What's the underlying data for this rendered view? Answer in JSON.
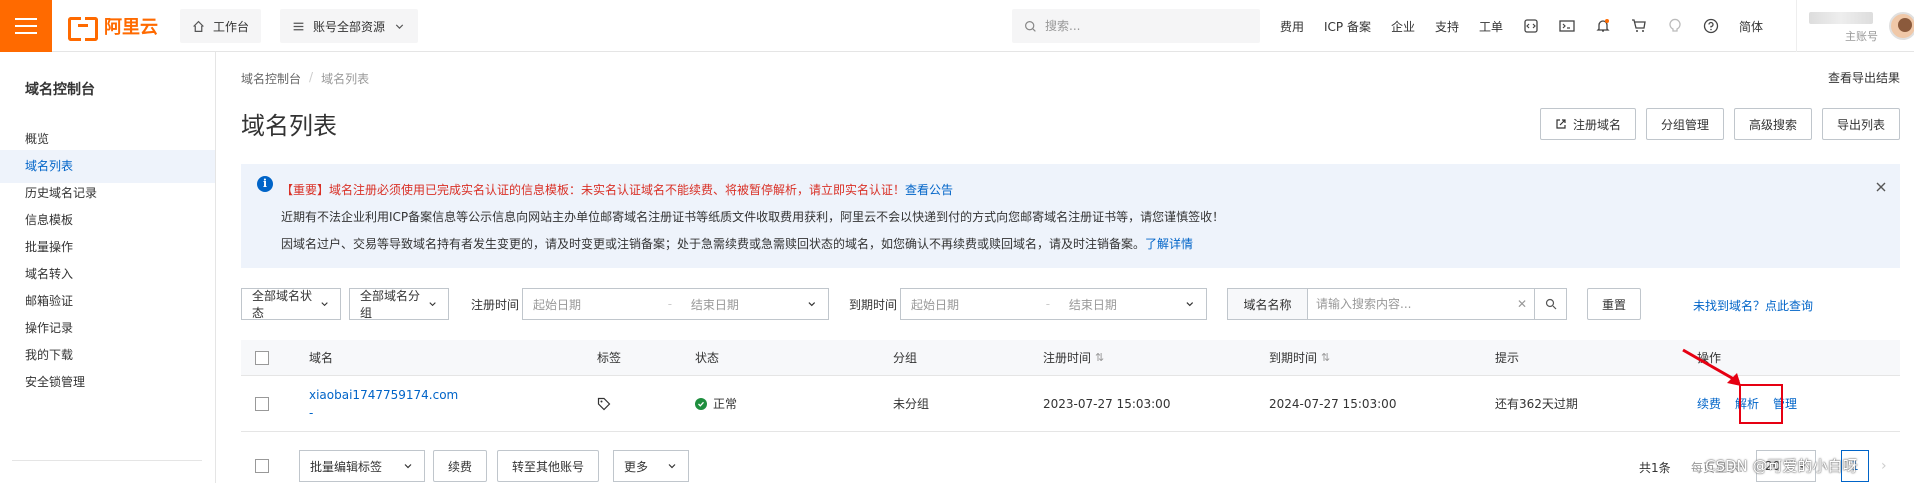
{
  "topbar": {
    "logo_text": "阿里云",
    "workbench_label": "工作台",
    "resource_label": "账号全部资源",
    "search_placeholder": "搜索...",
    "nav_links": [
      "费用",
      "ICP 备案",
      "企业",
      "支持",
      "工单"
    ],
    "lang_label": "简体",
    "user_sub": "主账号",
    "accent_color": "#ff6a00"
  },
  "sidebar": {
    "title": "域名控制台",
    "items": [
      {
        "label": "概览"
      },
      {
        "label": "域名列表",
        "active": true
      },
      {
        "label": "历史域名记录"
      },
      {
        "label": "信息模板"
      },
      {
        "label": "批量操作"
      },
      {
        "label": "域名转入"
      },
      {
        "label": "邮箱验证"
      },
      {
        "label": "操作记录"
      },
      {
        "label": "我的下载"
      },
      {
        "label": "安全锁管理"
      }
    ]
  },
  "main": {
    "breadcrumb": [
      "域名控制台",
      "域名列表"
    ],
    "export_link": "查看导出结果",
    "title": "域名列表",
    "header_buttons": {
      "register": "注册域名",
      "group": "分组管理",
      "advanced": "高级搜索",
      "export": "导出列表"
    }
  },
  "notice": {
    "line1_text": "【重要】域名注册必须使用已完成实名认证的信息模板：未实名认证域名不能续费、将被暂停解析，请立即实名认证！",
    "line1_link": "查看公告",
    "line2_text": "近期有不法企业利用ICP备案信息等公示信息向网站主办单位邮寄域名注册证书等纸质文件收取费用获利，阿里云不会以快递到付的方式向您邮寄域名注册证书等，请您谨慎签收！",
    "line3_text": "因域名过户、交易等导致域名持有者发生变更的，请及时变更或注销备案；处于急需续费或急需赎回状态的域名，如您确认不再续费或赎回域名，请及时注销备案。",
    "line3_link": "了解详情"
  },
  "filters": {
    "status_select": "全部域名状态",
    "group_select": "全部域名分组",
    "reg_time_label": "注册时间",
    "exp_time_label": "到期时间",
    "start_date": "起始日期",
    "end_date": "结束日期",
    "search_field": "域名名称",
    "search_placeholder": "请输入搜索内容...",
    "reset": "重置",
    "not_found": "未找到域名？点此查询"
  },
  "table": {
    "headers": {
      "domain": "域名",
      "tag": "标签",
      "status": "状态",
      "group": "分组",
      "reg_time": "注册时间",
      "exp_time": "到期时间",
      "tip": "提示",
      "ops": "操作"
    },
    "rows": [
      {
        "domain": "xiaobai1747759174.com",
        "domain_sub": "-",
        "status": "正常",
        "group": "未分组",
        "reg_time": "2023-07-27 15:03:00",
        "exp_time": "2024-07-27 15:03:00",
        "tip": "还有362天过期",
        "ops": [
          "续费",
          "解析",
          "管理"
        ]
      }
    ]
  },
  "footer": {
    "batch_tag": "批量编辑标签",
    "renew": "续费",
    "transfer": "转至其他账号",
    "more": "更多",
    "total": "共1条",
    "per_page_label": "每页显示:",
    "per_page": "20",
    "current_page": "1"
  },
  "watermark": "CSDN @可爱的小白呀"
}
